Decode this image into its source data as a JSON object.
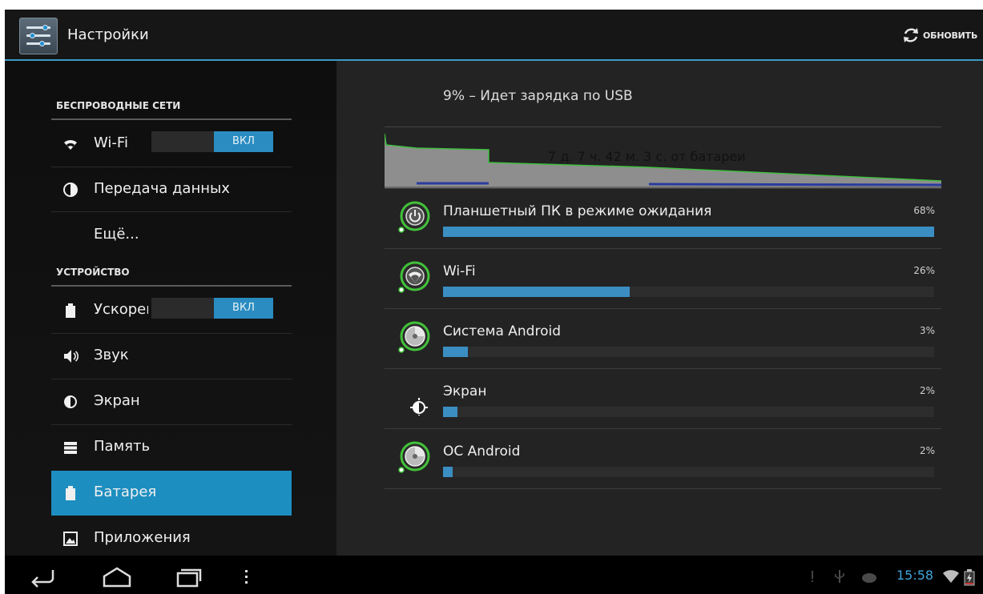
{
  "actionbar": {
    "title": "Настройки",
    "refresh_label": "ОБНОВИТЬ"
  },
  "sidebar": {
    "sections": [
      {
        "label": "БЕСПРОВОДНЫЕ СЕТИ"
      },
      {
        "label": "УСТРОЙСТВО"
      }
    ],
    "items": [
      {
        "label": "Wi-Fi",
        "icon": "wifi-icon",
        "toggle": "ВКЛ"
      },
      {
        "label": "Передача данных",
        "icon": "data-usage-icon"
      },
      {
        "label": "Ещё..."
      },
      {
        "label": "Ускорение",
        "icon": "battery-icon",
        "toggle": "ВКЛ"
      },
      {
        "label": "Звук",
        "icon": "speaker-icon"
      },
      {
        "label": "Экран",
        "icon": "brightness-icon"
      },
      {
        "label": "Память",
        "icon": "storage-icon"
      },
      {
        "label": "Батарея",
        "icon": "battery-icon",
        "selected": true
      },
      {
        "label": "Приложения",
        "icon": "apps-icon"
      }
    ]
  },
  "battery": {
    "status": "9% – Идет зарядка по USB",
    "graph_label": "7 д. 7 ч. 42 м. 3 с. от батареи",
    "apps": [
      {
        "name": "Планшетный ПК в режиме ожидания",
        "percent_label": "68%",
        "fraction": 1.0,
        "icon": "power-icon"
      },
      {
        "name": "Wi-Fi",
        "percent_label": "26%",
        "fraction": 0.38,
        "icon": "wifi-icon"
      },
      {
        "name": "Система Android",
        "percent_label": "3%",
        "fraction": 0.05,
        "icon": "android-system-icon"
      },
      {
        "name": "Экран",
        "percent_label": "2%",
        "fraction": 0.03,
        "icon": "brightness-icon"
      },
      {
        "name": "ОС Android",
        "percent_label": "2%",
        "fraction": 0.02,
        "icon": "android-os-icon"
      }
    ]
  },
  "systembar": {
    "time": "15:58"
  },
  "colors": {
    "accent": "#1d8ec0",
    "bar_fill": "#3b8ec2",
    "clock": "#3fa6dc"
  }
}
